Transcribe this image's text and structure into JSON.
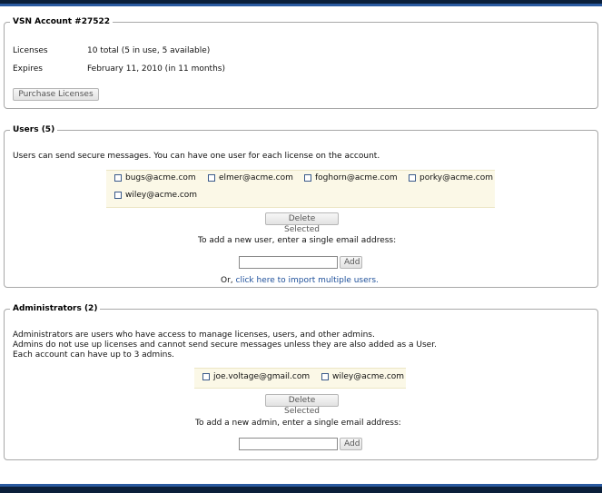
{
  "account": {
    "legend": "VSN Account #27522",
    "licenses_label": "Licenses",
    "licenses_value": "10 total (5 in use, 5 available)",
    "expires_label": "Expires",
    "expires_value": "February 11, 2010 (in 11 months)",
    "purchase_button": "Purchase Licenses"
  },
  "users": {
    "legend": "Users (5)",
    "description": "Users can send secure messages. You can have one user for each license on the account.",
    "list": [
      "bugs@acme.com",
      "elmer@acme.com",
      "foghorn@acme.com",
      "porky@acme.com",
      "wiley@acme.com"
    ],
    "delete_button": "Delete Selected",
    "add_prompt": "To add a new user, enter a single email address:",
    "add_input_value": "",
    "add_button": "Add",
    "import_prefix": "Or, ",
    "import_link": "click here to import multiple users."
  },
  "admins": {
    "legend": "Administrators (2)",
    "description_lines": [
      "Administrators are users who have access to manage licenses, users, and other admins.",
      "Admins do not use up licenses and cannot send secure messages unless they are also added as a User.",
      "Each account can have up to 3 admins."
    ],
    "list": [
      "joe.voltage@gmail.com",
      "wiley@acme.com"
    ],
    "delete_button": "Delete Selected",
    "add_prompt": "To add a new admin, enter a single email address:",
    "add_input_value": "",
    "add_button": "Add"
  },
  "colors": {
    "header_dark": "#0b1f3a",
    "header_light": "#2a5aa0",
    "list_bg": "#fbf8e7",
    "link": "#1d4f9a"
  }
}
